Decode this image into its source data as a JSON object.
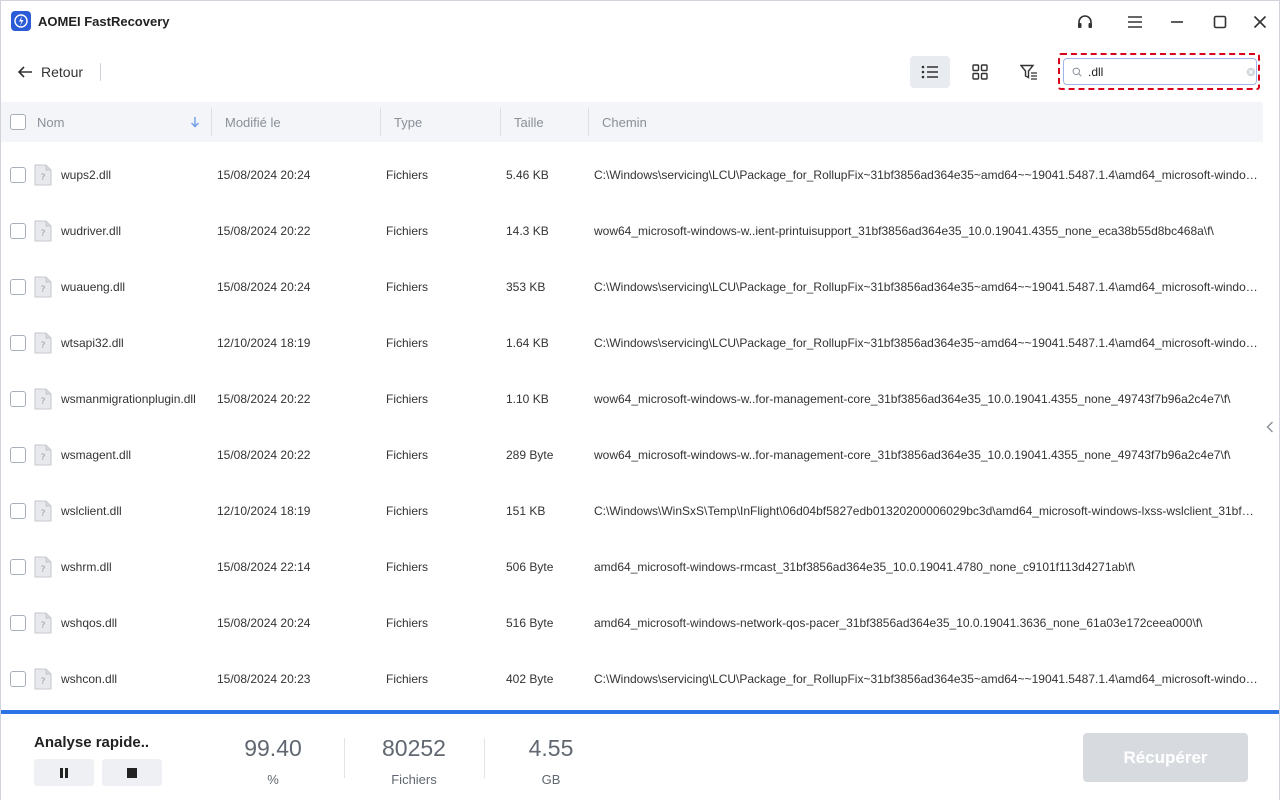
{
  "window": {
    "title": "AOMEI FastRecovery",
    "icons": [
      "support-headset-icon",
      "menu-icon",
      "minimize-icon",
      "maximize-icon",
      "close-icon"
    ]
  },
  "toolbar": {
    "back_label": "Retour",
    "view_buttons": [
      "list-view-icon",
      "grid-view-icon",
      "filter-icon"
    ],
    "search": {
      "value": ".dll",
      "placeholder": ""
    }
  },
  "table": {
    "columns": [
      "Nom",
      "Modifié le",
      "Type",
      "Taille",
      "Chemin"
    ],
    "rows": [
      {
        "name": "wups2.dll",
        "modified": "15/08/2024 20:24",
        "type": "Fichiers",
        "size": "5.46 KB",
        "path": "C:\\Windows\\servicing\\LCU\\Package_for_RollupFix~31bf3856ad364e35~amd64~~19041.5487.1.4\\amd64_microsoft-windows..."
      },
      {
        "name": "wudriver.dll",
        "modified": "15/08/2024 20:22",
        "type": "Fichiers",
        "size": "14.3 KB",
        "path": "wow64_microsoft-windows-w..ient-printuisupport_31bf3856ad364e35_10.0.19041.4355_none_eca38b55d8bc468a\\f\\"
      },
      {
        "name": "wuaueng.dll",
        "modified": "15/08/2024 20:24",
        "type": "Fichiers",
        "size": "353 KB",
        "path": "C:\\Windows\\servicing\\LCU\\Package_for_RollupFix~31bf3856ad364e35~amd64~~19041.5487.1.4\\amd64_microsoft-windows..."
      },
      {
        "name": "wtsapi32.dll",
        "modified": "12/10/2024 18:19",
        "type": "Fichiers",
        "size": "1.64 KB",
        "path": "C:\\Windows\\servicing\\LCU\\Package_for_RollupFix~31bf3856ad364e35~amd64~~19041.5487.1.4\\amd64_microsoft-windows..."
      },
      {
        "name": "wsmanmigrationplugin.dll",
        "modified": "15/08/2024 20:22",
        "type": "Fichiers",
        "size": "1.10 KB",
        "path": "wow64_microsoft-windows-w..for-management-core_31bf3856ad364e35_10.0.19041.4355_none_49743f7b96a2c4e7\\f\\"
      },
      {
        "name": "wsmagent.dll",
        "modified": "15/08/2024 20:22",
        "type": "Fichiers",
        "size": "289 Byte",
        "path": "wow64_microsoft-windows-w..for-management-core_31bf3856ad364e35_10.0.19041.4355_none_49743f7b96a2c4e7\\f\\"
      },
      {
        "name": "wslclient.dll",
        "modified": "12/10/2024 18:19",
        "type": "Fichiers",
        "size": "151 KB",
        "path": "C:\\Windows\\WinSxS\\Temp\\InFlight\\06d04bf5827edb01320200006029bc3d\\amd64_microsoft-windows-lxss-wslclient_31bf38..."
      },
      {
        "name": "wshrm.dll",
        "modified": "15/08/2024 22:14",
        "type": "Fichiers",
        "size": "506 Byte",
        "path": "amd64_microsoft-windows-rmcast_31bf3856ad364e35_10.0.19041.4780_none_c9101f113d4271ab\\f\\"
      },
      {
        "name": "wshqos.dll",
        "modified": "15/08/2024 20:24",
        "type": "Fichiers",
        "size": "516 Byte",
        "path": "amd64_microsoft-windows-network-qos-pacer_31bf3856ad364e35_10.0.19041.3636_none_61a03e172ceea000\\f\\"
      },
      {
        "name": "wshcon.dll",
        "modified": "15/08/2024 20:23",
        "type": "Fichiers",
        "size": "402 Byte",
        "path": "C:\\Windows\\servicing\\LCU\\Package_for_RollupFix~31bf3856ad364e35~amd64~~19041.5487.1.4\\amd64_microsoft-windows..."
      }
    ]
  },
  "footer": {
    "scan_label": "Analyse rapide..",
    "progress": {
      "value": "99.40",
      "unit": "%"
    },
    "files": {
      "value": "80252",
      "unit": "Fichiers"
    },
    "size": {
      "value": "4.55",
      "unit": "GB"
    },
    "recover_label": "Récupérer"
  },
  "colors": {
    "accent": "#2e74e6",
    "search_highlight": "#d9001b",
    "disabled_button": "#d7dbe0"
  }
}
